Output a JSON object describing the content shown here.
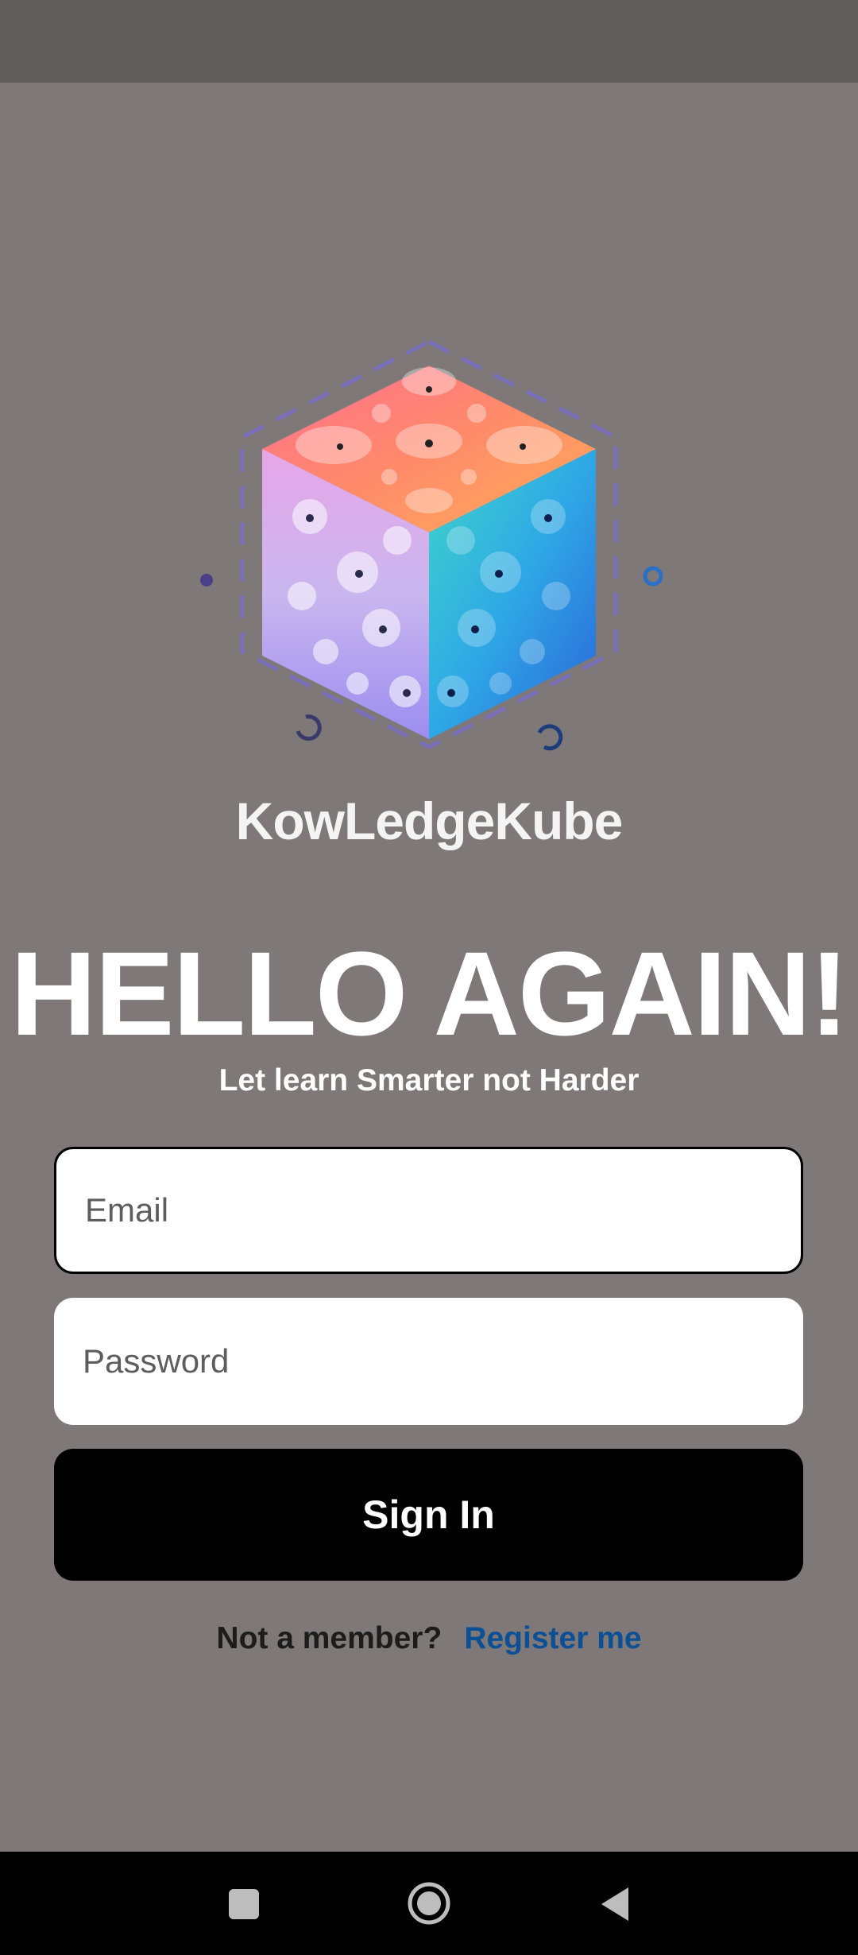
{
  "app": {
    "brand_name": "KowLedgeKube",
    "logo_icon": "cube-logo-icon"
  },
  "login": {
    "headline": "HELLO AGAIN!",
    "subtitle": "Let learn Smarter not Harder",
    "email_placeholder": "Email",
    "email_value": "",
    "password_placeholder": "Password",
    "password_value": "",
    "signin_label": "Sign In",
    "not_member_text": "Not a member?",
    "register_link": "Register me"
  },
  "colors": {
    "background": "#7e7878",
    "status_bar": "#615d5c",
    "button": "#000000",
    "link": "#0d4f94"
  },
  "nav": {
    "recents_icon": "square-icon",
    "home_icon": "circle-home-icon",
    "back_icon": "triangle-back-icon"
  }
}
